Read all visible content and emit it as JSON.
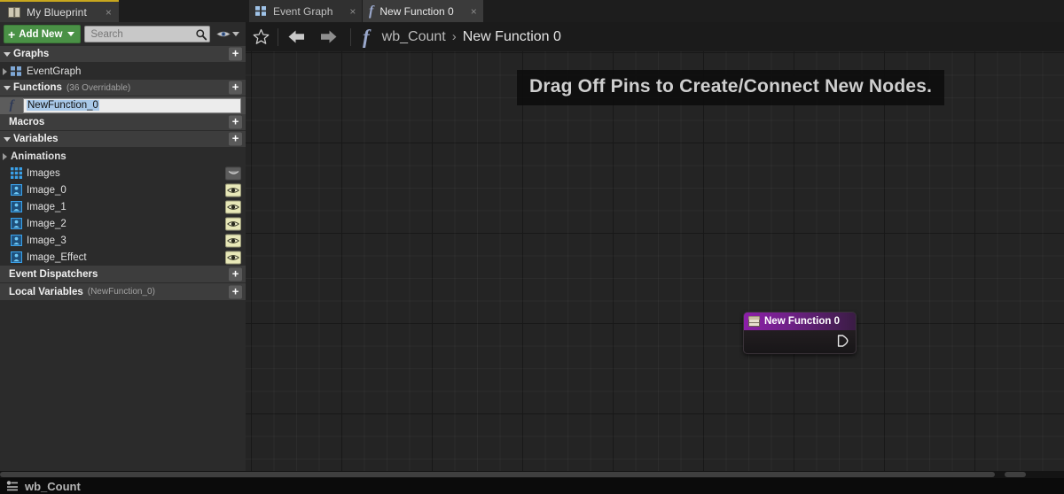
{
  "left_panel": {
    "tab": {
      "label": "My Blueprint",
      "icon": "book-icon",
      "close": "×"
    },
    "toolbar": {
      "add_new_label": "Add New",
      "search_placeholder": "Search",
      "search_value": "",
      "search_icon": "magnifier-icon",
      "visibility_icon": "eye-icon"
    },
    "sections": {
      "graphs": {
        "label": "Graphs",
        "add": "+"
      },
      "functions": {
        "label": "Functions",
        "note": "(36 Overridable)",
        "add": "+"
      },
      "macros": {
        "label": "Macros",
        "add": "+"
      },
      "variables": {
        "label": "Variables",
        "add": "+"
      },
      "event_dispatchers": {
        "label": "Event Dispatchers",
        "add": "+"
      },
      "local_variables": {
        "label": "Local Variables",
        "note": "(NewFunction_0)",
        "add": "+"
      }
    },
    "graphs_items": [
      {
        "label": "EventGraph",
        "icon": "event-graph-icon"
      }
    ],
    "functions_items": [
      {
        "label": "NewFunction_0",
        "icon": "function-icon",
        "editing": true,
        "selected": true
      }
    ],
    "variables_items": [
      {
        "label": "Animations",
        "icon": "category-icon",
        "type": "category",
        "eye": "none"
      },
      {
        "label": "Images",
        "icon": "array-icon",
        "type": "array",
        "eye": "closed"
      },
      {
        "label": "Image_0",
        "icon": "object-ref-icon",
        "type": "object",
        "eye": "open"
      },
      {
        "label": "Image_1",
        "icon": "object-ref-icon",
        "type": "object",
        "eye": "open"
      },
      {
        "label": "Image_2",
        "icon": "object-ref-icon",
        "type": "object",
        "eye": "open"
      },
      {
        "label": "Image_3",
        "icon": "object-ref-icon",
        "type": "object",
        "eye": "open"
      },
      {
        "label": "Image_Effect",
        "icon": "object-ref-icon",
        "type": "object",
        "eye": "open"
      }
    ]
  },
  "graph_area": {
    "tabs": [
      {
        "label": "Event Graph",
        "icon": "event-graph-icon",
        "active": false,
        "close": "×"
      },
      {
        "label": "New Function 0",
        "icon": "function-icon",
        "active": true,
        "close": "×"
      }
    ],
    "breadcrumb": {
      "favorite_icon": "star-icon",
      "back_icon": "arrow-left-icon",
      "forward_icon": "arrow-right-icon",
      "function_icon": "function-icon",
      "parent": "wb_Count",
      "separator": "›",
      "current": "New Function 0"
    },
    "hint_banner": "Drag Off Pins to Create/Connect New Nodes.",
    "node": {
      "title": "New Function 0",
      "icon": "function-entry-icon",
      "exec_pin": "exec-output-pin",
      "header_color": "#8c1fa8"
    }
  },
  "status_bar": {
    "icon": "blueprint-icon",
    "text": "wb_Count"
  },
  "colors": {
    "accent_green": "#4a9146",
    "tab_accent": "#c8a71e",
    "node_purple": "#8c1fa8",
    "selection_blue": "#a8c8e8",
    "panel_bg": "#2b2b2b",
    "graph_bg": "#242424"
  }
}
